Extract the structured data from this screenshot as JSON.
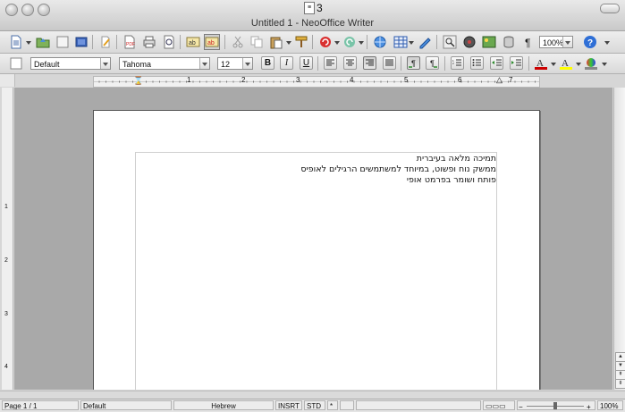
{
  "window": {
    "doc_number": "3",
    "title": "Untitled 1 - NeoOffice Writer"
  },
  "formatting": {
    "paragraph_style": "Default",
    "font_name": "Tahoma",
    "font_size": "12",
    "zoom_value": "100%"
  },
  "ruler": {
    "h_marks": [
      "1",
      "2",
      "3",
      "4",
      "5",
      "6",
      "7"
    ],
    "v_marks": [
      "1",
      "2",
      "3",
      "4"
    ]
  },
  "document": {
    "lines": [
      "תמיכה מלאה בעיברית",
      "ממשק נוח ופשוט, במיוחד למשתמשים הרגילים לאופיס",
      "פותח ושומר בפרמט אופי"
    ]
  },
  "status": {
    "page": "Page 1 / 1",
    "page_style": "Default",
    "language": "Hebrew",
    "insert_mode": "INSRT",
    "selection_mode": "STD",
    "modified": "*",
    "zoom_percent": "100%"
  },
  "colors": {
    "font_color": "#cc0000",
    "highlight_color": "#ffff00"
  }
}
